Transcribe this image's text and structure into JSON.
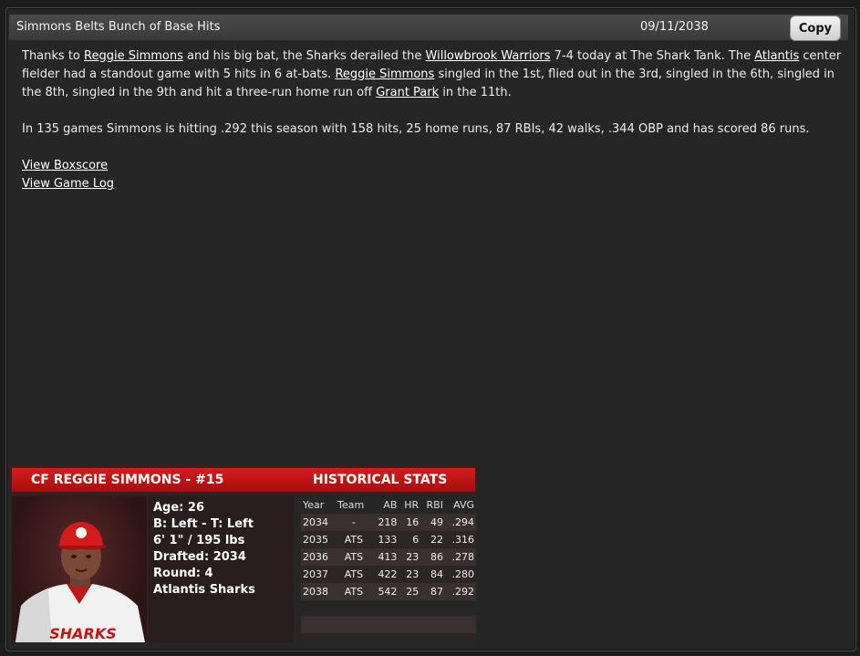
{
  "header": {
    "title": "Simmons Belts Bunch of Base Hits",
    "date": "09/11/2038",
    "copy_label": "Copy"
  },
  "story": {
    "p1": {
      "t1": "Thanks to ",
      "link_player1": "Reggie Simmons",
      "t2": " and his big bat, the Sharks derailed the ",
      "link_opponent": "Willowbrook Warriors",
      "t3": " 7-4 today at The Shark Tank. The ",
      "link_team": "Atlantis",
      "t4": " center fielder had a standout game with 5 hits in 6 at-bats. ",
      "link_player2": "Reggie Simmons",
      "t5": " singled in the 1st, flied out in the 3rd, singled in the 6th, singled in the 8th, singled in the 9th and hit a three-run home run off ",
      "link_pitcher": "Grant Park",
      "t6": " in the 11th."
    },
    "p2": "In 135 games Simmons is hitting .292 this season with 158 hits, 25 home runs, 87 RBIs, 42 walks, .344 OBP and has scored 86 runs.",
    "links": {
      "boxscore": "View Boxscore",
      "gamelog": "View Game Log"
    }
  },
  "card": {
    "player_title": "CF REGGIE SIMMONS - #15",
    "hist_title": "HISTORICAL STATS",
    "jersey_text": "SHARKS",
    "bio": {
      "age": "Age: 26",
      "bats_throws": "B: Left - T: Left",
      "size": "6' 1\" / 195 lbs",
      "drafted": "Drafted: 2034",
      "round": "Round: 4",
      "team": "Atlantis Sharks"
    },
    "stats_headers": [
      "Year",
      "Team",
      "AB",
      "HR",
      "RBI",
      "AVG"
    ],
    "stats_rows": [
      [
        "2034",
        "-",
        "218",
        "16",
        "49",
        ".294"
      ],
      [
        "2035",
        "ATS",
        "133",
        "6",
        "22",
        ".316"
      ],
      [
        "2036",
        "ATS",
        "413",
        "23",
        "86",
        ".278"
      ],
      [
        "2037",
        "ATS",
        "422",
        "23",
        "84",
        ".280"
      ],
      [
        "2038",
        "ATS",
        "542",
        "25",
        "87",
        ".292"
      ]
    ]
  },
  "colors": {
    "accent_red": "#c41414",
    "background": "#262626"
  }
}
